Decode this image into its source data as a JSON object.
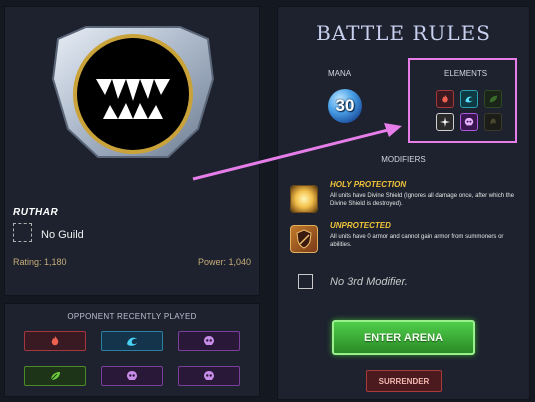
{
  "player": {
    "name": "RUTHAR",
    "guild": "No Guild",
    "rating": "Rating: 1,180",
    "power": "Power: 1,040"
  },
  "opponent": {
    "title": "OPPONENT RECENTLY PLAYED",
    "elements": [
      "fire",
      "water",
      "death",
      "earth",
      "death",
      "death"
    ]
  },
  "rules": {
    "title": "BATTLE RULES",
    "mana_label": "MANA",
    "mana_value": "30",
    "elements_label": "ELEMENTS",
    "elements": [
      {
        "name": "fire",
        "allowed": true
      },
      {
        "name": "water",
        "allowed": true
      },
      {
        "name": "earth",
        "allowed": false
      },
      {
        "name": "life",
        "allowed": true
      },
      {
        "name": "death",
        "allowed": true
      },
      {
        "name": "dragon",
        "allowed": false
      }
    ],
    "modifiers_label": "MODIFIERS",
    "modifiers": [
      {
        "title": "HOLY PROTECTION",
        "desc": "All units have Divine Shield (Ignores all damage once, after which the Divine Shield is destroyed)."
      },
      {
        "title": "UNPROTECTED",
        "desc": "All units have 0 armor and cannot gain armor from summoners or abilities."
      }
    ],
    "third_modifier": "No 3rd Modifier."
  },
  "actions": {
    "enter_label": "ENTER ARENA",
    "surrender_label": "SURRENDER"
  },
  "annotation_color": "#e67de9"
}
